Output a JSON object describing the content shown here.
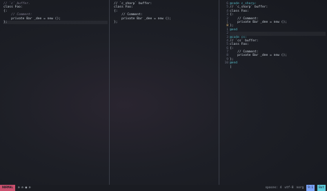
{
  "pane1": {
    "lines": [
      {
        "cls": "cmt",
        "text": "// `c` buffer."
      },
      {
        "cls": "kw",
        "text": "class Foo:"
      },
      {
        "cls": "kw",
        "text": "{:"
      },
      {
        "cls": "cmt",
        "text": "    // Comment:"
      },
      {
        "cls": "kw",
        "text": "    private Bar _dee = new ();"
      },
      {
        "cls": "kw",
        "text": "};"
      }
    ]
  },
  "pane2": {
    "lines": [
      {
        "cls": "kw",
        "text": "// `c_sharp` buffer:"
      },
      {
        "cls": "kw",
        "text": "class Foo:"
      },
      {
        "cls": "kw",
        "text": "{:"
      },
      {
        "cls": "kw",
        "text": "    // Comment:"
      },
      {
        "cls": "kw",
        "text": "    private Bar _dee = new ();"
      },
      {
        "cls": "kw",
        "text": "};"
      }
    ]
  },
  "pane3": {
    "gutter": [
      "6",
      "5",
      "4",
      "3",
      "2",
      "1",
      "8",
      "1",
      "2",
      "3",
      "4",
      "5",
      "6",
      "7",
      "8",
      "9",
      "10"
    ],
    "lines": [
      {
        "cls": "fold",
        "text": "@code c_sharp:"
      },
      {
        "cls": "kw",
        "text": "// `c_sharp` buffer:"
      },
      {
        "cls": "kw",
        "text": "class Foo:"
      },
      {
        "cls": "kw",
        "text": "{:"
      },
      {
        "cls": "kw",
        "text": "    // Comment:"
      },
      {
        "cls": "kw",
        "text": "    private Bar _dee = new ();"
      },
      {
        "cls": "kw",
        "text": "};"
      },
      {
        "cls": "fold",
        "text": "@end"
      },
      {
        "cls": "kw",
        "text": ""
      },
      {
        "cls": "fold",
        "text": "@code cs:"
      },
      {
        "cls": "kw",
        "text": "// `cs` buffer:"
      },
      {
        "cls": "kw",
        "text": "class Foo:"
      },
      {
        "cls": "kw",
        "text": "{:"
      },
      {
        "cls": "kw",
        "text": "    // Comment:"
      },
      {
        "cls": "kw",
        "text": "    private Bar _dee = new ();"
      },
      {
        "cls": "kw",
        "text": "};"
      },
      {
        "cls": "fold",
        "text": "@end"
      },
      {
        "cls": "kw",
        "text": "|"
      }
    ]
  },
  "status": {
    "mode": "NORMAL",
    "icons": "⊙ ⊙ ◉ ⊙",
    "spaces": "spaces: 4",
    "encoding": "utf-8",
    "filetype": "norg",
    "position": "9:1",
    "percent": "Bot"
  }
}
